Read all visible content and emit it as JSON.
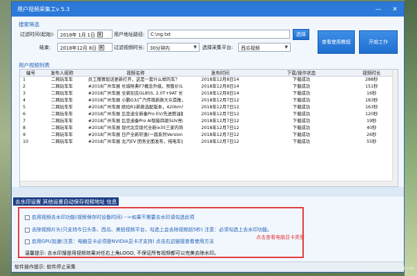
{
  "window": {
    "title": "用户视频采集工v 5.3"
  },
  "search": {
    "section_label": "搜索筛选",
    "date_from_label": "过滤时间(起始):",
    "date_from_value": "2018年 1月 1日",
    "date_to_label": "结束:",
    "date_to_value": "2018年12月 8日",
    "user_path_label": "用户地址路径:",
    "user_path_value": "C:\\ng.txt",
    "browse_label": "选择",
    "filter_duration_label": "过滤视频时长:",
    "filter_duration_value": "30分钟内",
    "platform_label": "选择采集平台:",
    "platform_value": "西瓜视频",
    "help_button": "查看使用教程",
    "start_button": "开始工作"
  },
  "table": {
    "section_label": "用户视频列表",
    "headers": [
      "编号",
      "发布人昵称",
      "视频名称",
      "发布时间",
      "下载/操作状态",
      "视频时长"
    ],
    "rows": [
      [
        "1",
        "二网玩车车",
        "员工猜猜现话更新打开，这是一套什么样的车？",
        "2018年12月8日14",
        "下载成功",
        "288秒"
      ],
      [
        "2",
        "二网玩车车",
        "#2018广州车展 长城哈弗F7概念升级，预售价(L.52,060...",
        "2018年12月8日14",
        "下载成功",
        "151秒"
      ],
      [
        "3",
        "二网玩车车",
        "#2018广州车展 全新别克GL8SS, 2.0T+9AT 长安自主标准版",
        "2018年12月8日14",
        "下载成功",
        "16秒"
      ],
      [
        "4",
        "二网玩车车",
        "#2018广州车展 小鹏G3/广汽传祺新款大众首推，将于12月12日",
        "2018年12月7日12",
        "下载成功",
        "183秒"
      ],
      [
        "5",
        "二网玩车车",
        "#2018广州车展 欧拉R1新款选配版本，420km！预售10.29...",
        "2018年12月7日12",
        "下载成功",
        "163秒"
      ],
      [
        "6",
        "二网玩车车",
        "#2018广州车展 比亚迪全新秦Pro EV/先进燃油版本了Pro...",
        "2018年12月7日12",
        "下载成功",
        "120秒"
      ],
      [
        "7",
        "二网玩车车",
        "#2018广州车展 比亚迪秦Pro AI智能四驱SUV亮相广州车展",
        "2018年12月7日12",
        "下载成功",
        "19秒"
      ],
      [
        "8",
        "二网玩车车",
        "#2018广州车展 现代北京现代全新ix35三家内饰升级！...",
        "2018年12月7日12",
        "下载成功",
        "40秒"
      ],
      [
        "9",
        "二网玩车车",
        "#2018广州车展 日产全新轩逸(一届系列Version 2.0版)...",
        "2018年12月7日12",
        "下载成功",
        "26秒"
      ],
      [
        "10",
        "二网玩车车",
        "#2018广州车展 北汽EV 团务全面发布，纯电车设计SUV新版",
        "2018年12月7日12",
        "下载成功",
        "55秒"
      ]
    ]
  },
  "settings": {
    "tabs_label": "去水印设置 其他设置自动保存视频地址 信息",
    "options": [
      "启用视频去水印功能(视频保存时设备时间) -->如果不需要去水印请勾选此项",
      "去除视频片头(只支持今日头条、西瓜、美拍视频平台，勾选上会去除视频前5秒) 注意：必须勾选上去水印功能。",
      "启用GPU加速(注意：电脑显卡必须是NVIDIA显卡才支持) 点击右边链接查看使用方法"
    ],
    "red_link": "点击查看电脑显卡类型",
    "tip": "温馨提示: 去水印搜是用视频效果对任右上角LOGO, 不保证所有视频都可以完美去除水印。"
  },
  "statusbar": {
    "text": "软件操作提示: 软件停止采集"
  },
  "watermark": "www.xuzhi.net"
}
